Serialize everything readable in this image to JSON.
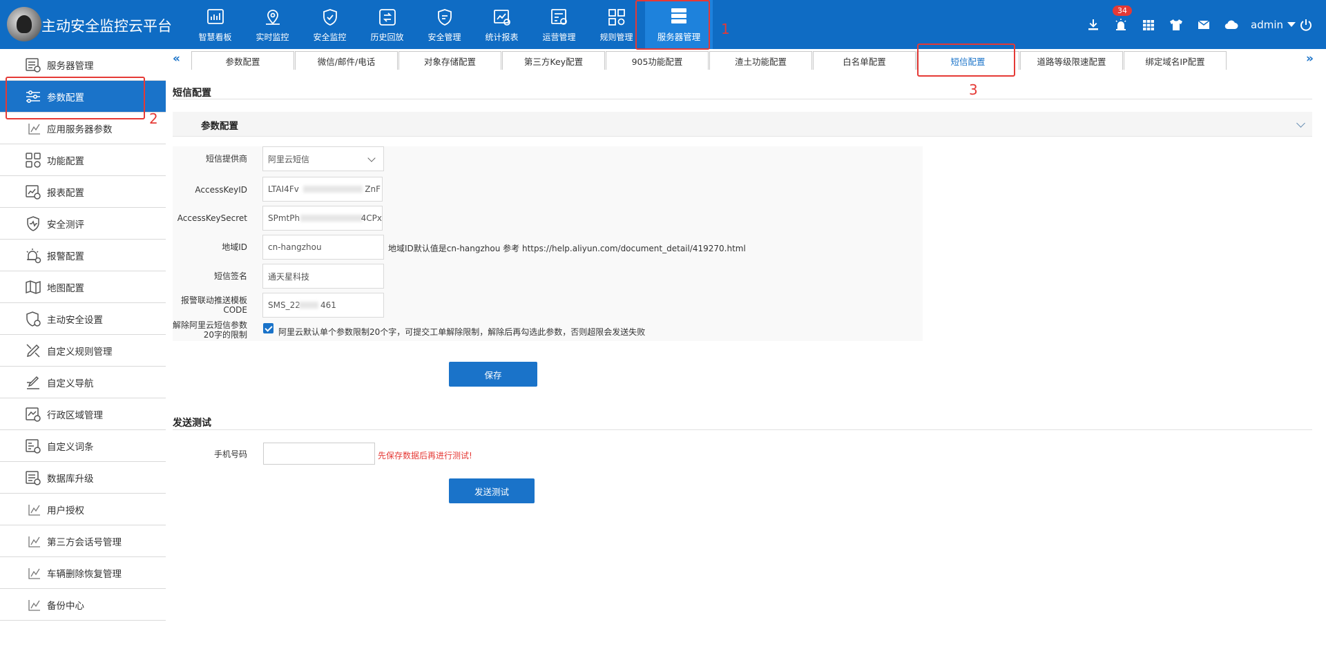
{
  "header": {
    "app_title": "主动安全监控云平台",
    "nav": [
      {
        "label": "智慧看板",
        "icon": "dashboard-icon"
      },
      {
        "label": "实时监控",
        "icon": "map-pin-icon"
      },
      {
        "label": "安全监控",
        "icon": "shield-icon"
      },
      {
        "label": "历史回放",
        "icon": "replay-icon"
      },
      {
        "label": "安全管理",
        "icon": "shield-settings-icon"
      },
      {
        "label": "统计报表",
        "icon": "report-icon"
      },
      {
        "label": "运营管理",
        "icon": "operations-icon"
      },
      {
        "label": "规则管理",
        "icon": "rules-icon"
      },
      {
        "label": "服务器管理",
        "icon": "server-icon"
      }
    ],
    "annotation_1": "1",
    "alarm_badge": "34",
    "username": "admin"
  },
  "sidebar": {
    "items": [
      {
        "label": "服务器管理",
        "icon": "server-list-icon"
      },
      {
        "label": "参数配置",
        "icon": "sliders-icon"
      },
      {
        "label": "应用服务器参数",
        "icon": "chart-line-icon"
      },
      {
        "label": "功能配置",
        "icon": "grid-icon"
      },
      {
        "label": "报表配置",
        "icon": "report-settings-icon"
      },
      {
        "label": "安全测评",
        "icon": "evaluation-icon"
      },
      {
        "label": "报警配置",
        "icon": "alarm-settings-icon"
      },
      {
        "label": "地图配置",
        "icon": "map-icon"
      },
      {
        "label": "主动安全设置",
        "icon": "shield-gear-icon"
      },
      {
        "label": "自定义规则管理",
        "icon": "rule-edit-icon"
      },
      {
        "label": "自定义导航",
        "icon": "nav-edit-icon"
      },
      {
        "label": "行政区域管理",
        "icon": "region-icon"
      },
      {
        "label": "自定义词条",
        "icon": "dictionary-icon"
      },
      {
        "label": "数据库升级",
        "icon": "database-icon"
      },
      {
        "label": "用户授权",
        "icon": "chart-line-icon"
      },
      {
        "label": "第三方会话号管理",
        "icon": "chart-line-icon"
      },
      {
        "label": "车辆删除恢复管理",
        "icon": "chart-line-icon"
      },
      {
        "label": "备份中心",
        "icon": "chart-line-icon"
      }
    ],
    "annotation_2": "2"
  },
  "tabs": {
    "items": [
      "参数配置",
      "微信/邮件/电话",
      "对象存储配置",
      "第三方Key配置",
      "905功能配置",
      "渣土功能配置",
      "白名单配置",
      "短信配置",
      "道路等级限速配置",
      "绑定域名IP配置"
    ],
    "prev": "«",
    "next": "»",
    "annotation_3": "3"
  },
  "main": {
    "title": "短信配置",
    "panel_title": "参数配置",
    "form": {
      "provider_label": "短信提供商",
      "provider_value": "阿里云短信",
      "access_key_id_label": "AccessKeyID",
      "access_key_id_prefix": "LTAI4Fv",
      "access_key_id_suffix": "ZnF",
      "access_key_secret_label": "AccessKeySecret",
      "access_key_secret_prefix": "SPmtPh",
      "access_key_secret_suffix": "4CPx",
      "region_label": "地域ID",
      "region_value": "cn-hangzhou",
      "region_hint": "地域ID默认值是cn-hangzhou 参考 https://help.aliyun.com/document_detail/419270.html",
      "sign_label": "短信签名",
      "sign_value": "通天星科技",
      "template_label_1": "报警联动推送模板",
      "template_label_2": "CODE",
      "template_prefix": "SMS_22",
      "template_suffix": "461",
      "limit_label_1": "解除阿里云短信参数",
      "limit_label_2": "20字的限制",
      "limit_checked": true,
      "limit_hint": "阿里云默认单个参数限制20个字，可提交工单解除限制，解除后再勾选此参数，否则超限会发送失败",
      "save_label": "保存"
    },
    "test": {
      "title": "发送测试",
      "phone_label": "手机号码",
      "phone_value": "",
      "warning": "先保存数据后再进行测试!",
      "send_label": "发送测试"
    }
  },
  "colors": {
    "header_bg": "#0f6cc4",
    "accent": "#1a73c9",
    "annotation": "#e53935"
  }
}
